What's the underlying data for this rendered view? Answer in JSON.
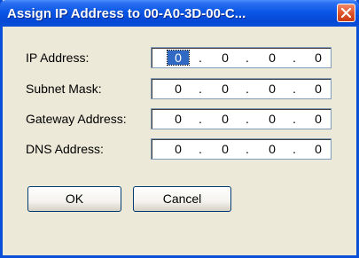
{
  "window": {
    "title": "Assign IP Address to 00-A0-3D-00-C..."
  },
  "fields": [
    {
      "label": "IP Address:",
      "octets": [
        "0",
        "0",
        "0",
        "0"
      ],
      "separator": "."
    },
    {
      "label": "Subnet Mask:",
      "octets": [
        "0",
        "0",
        "0",
        "0"
      ],
      "separator": "."
    },
    {
      "label": "Gateway Address:",
      "octets": [
        "0",
        "0",
        "0",
        "0"
      ],
      "separator": "."
    },
    {
      "label": "DNS Address:",
      "octets": [
        "0",
        "0",
        "0",
        "0"
      ],
      "separator": "."
    }
  ],
  "buttons": {
    "ok_label": "OK",
    "cancel_label": "Cancel"
  },
  "colors": {
    "titlebar": "#0a56e6",
    "close_button": "#e0562c",
    "dialog_background": "#ece9d8",
    "selection": "#316ac5"
  }
}
